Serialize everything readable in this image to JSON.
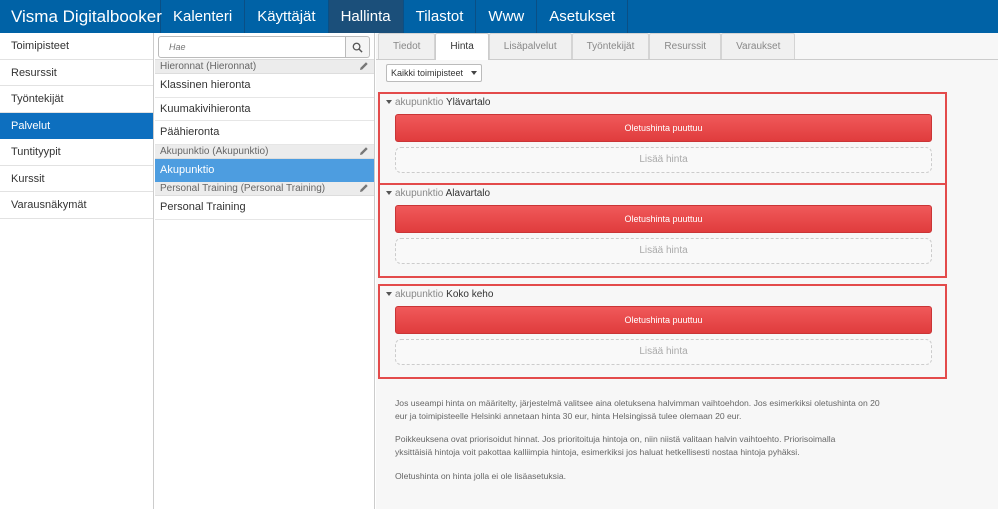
{
  "app": {
    "title": "Visma Digitalbooker"
  },
  "topnav": [
    {
      "label": "Kalenteri",
      "active": false
    },
    {
      "label": "Käyttäjät",
      "active": false
    },
    {
      "label": "Hallinta",
      "active": true
    },
    {
      "label": "Tilastot",
      "active": false
    },
    {
      "label": "Www",
      "active": false
    },
    {
      "label": "Asetukset",
      "active": false
    }
  ],
  "sidebar": {
    "items": [
      {
        "label": "Toimipisteet"
      },
      {
        "label": "Resurssit"
      },
      {
        "label": "Työntekijät"
      },
      {
        "label": "Palvelut"
      },
      {
        "label": "Tuntityypit"
      },
      {
        "label": "Kurssit"
      },
      {
        "label": "Varausnäkymät"
      }
    ],
    "active_index": 3
  },
  "search": {
    "placeholder": "Hae",
    "icon": "search-icon"
  },
  "service_list": {
    "groups": [
      {
        "header": "Hieronnat (Hieronnat)",
        "items": [
          "Klassinen hieronta",
          "Kuumakivihieronta",
          "Päähieronta"
        ]
      },
      {
        "header": "Akupunktio (Akupunktio)",
        "items": [
          "Akupunktio"
        ]
      },
      {
        "header": "Personal Training (Personal Training)",
        "items": [
          "Personal Training"
        ]
      }
    ],
    "selected": "Akupunktio"
  },
  "tabs": [
    {
      "label": "Tiedot"
    },
    {
      "label": "Hinta"
    },
    {
      "label": "Lisäpalvelut"
    },
    {
      "label": "Työntekijät"
    },
    {
      "label": "Resurssit"
    },
    {
      "label": "Varaukset"
    }
  ],
  "active_tab": "Hinta",
  "filter": {
    "label": "Kaikki toimipisteet"
  },
  "price_blocks": [
    {
      "prefix": "akupunktio",
      "name": "Ylävartalo",
      "missing_label": "Oletushinta puuttuu",
      "add_label": "Lisää hinta"
    },
    {
      "prefix": "akupunktio",
      "name": "Alavartalo",
      "missing_label": "Oletushinta puuttuu",
      "add_label": "Lisää hinta"
    },
    {
      "prefix": "akupunktio",
      "name": "Koko keho",
      "missing_label": "Oletushinta puuttuu",
      "add_label": "Lisää hinta"
    }
  ],
  "help": {
    "p1_line1": "Jos useampi hinta on määritelty, järjestelmä valitsee aina oletuksena halvimman vaihtoehdon. Jos esimerkiksi oletushinta on 20",
    "p1_line2": "eur ja toimipisteelle Helsinki annetaan hinta 30 eur, hinta Helsingissä tulee olemaan 20 eur.",
    "p2_line1": "Poikkeuksena ovat priorisoidut hinnat. Jos prioritoituja hintoja on, niin niistä valitaan halvin vaihtoehto. Priorisoimalla",
    "p2_line2": "yksittäisiä hintoja voit pakottaa kalliimpia hintoja, esimerkiksi jos haluat hetkellisesti nostaa hintoja pyhäksi.",
    "p3": "Oletushinta on hinta jolla ei ole lisäasetuksia."
  },
  "colors": {
    "topbar": "#0062a6",
    "active_nav": "#1b4f7a",
    "sidebar_active": "#0d6fbf",
    "list_active": "#4d9de0",
    "alert_red": "#e34b4b"
  }
}
